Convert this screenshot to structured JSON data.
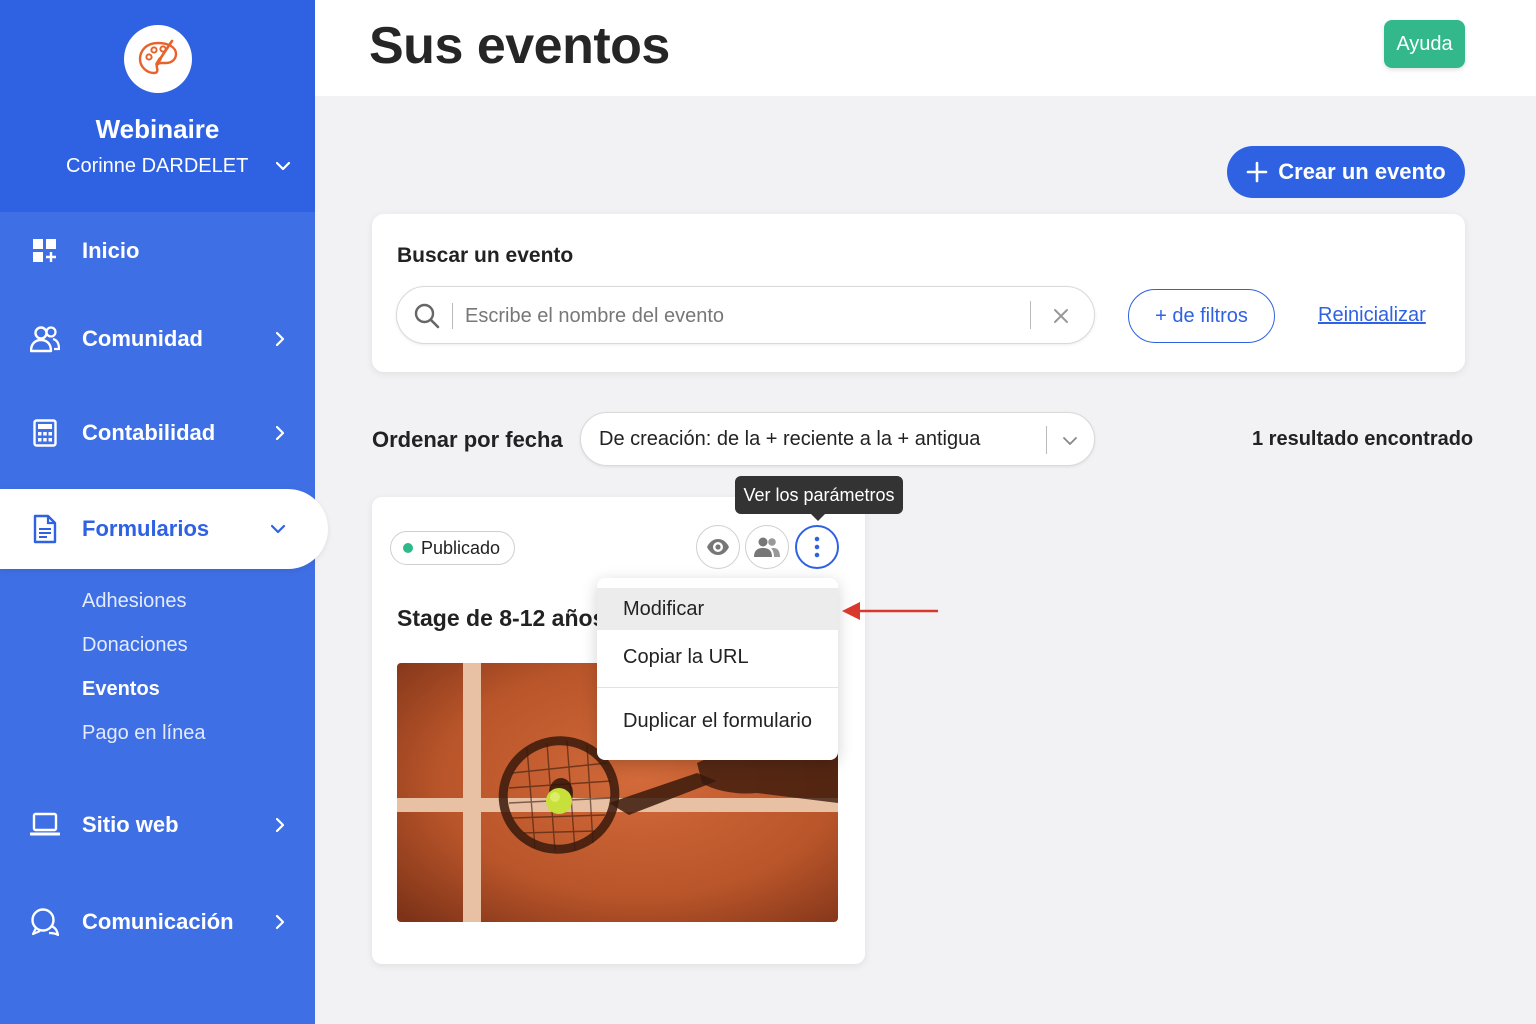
{
  "sidebar": {
    "org_name": "Webinaire",
    "user_name": "Corinne DARDELET",
    "nav": [
      {
        "label": "Inicio",
        "icon": "dashboard-icon"
      },
      {
        "label": "Comunidad",
        "icon": "users-icon"
      },
      {
        "label": "Contabilidad",
        "icon": "calculator-icon"
      },
      {
        "label": "Formularios",
        "icon": "document-icon"
      },
      {
        "label": "Sitio web",
        "icon": "laptop-icon"
      },
      {
        "label": "Comunicación",
        "icon": "chat-icon"
      }
    ],
    "subnav": [
      "Adhesiones",
      "Donaciones",
      "Eventos",
      "Pago en línea"
    ],
    "active_subnav": "Eventos"
  },
  "header": {
    "title": "Sus eventos",
    "help_label": "Ayuda"
  },
  "create_button": "Crear un evento",
  "search": {
    "title": "Buscar un evento",
    "placeholder": "Escribe el nombre del evento",
    "filters_label": "+ de filtros",
    "reset_label": "Reinicializar"
  },
  "sort": {
    "label": "Ordenar por fecha",
    "value": "De creación: de la + reciente a la + antigua",
    "result_count": "1 resultado encontrado"
  },
  "event": {
    "status": "Publicado",
    "title": "Stage de 8-12 años"
  },
  "tooltip": "Ver los parámetros",
  "menu": {
    "items": [
      "Modificar",
      "Copiar la URL",
      "Duplicar el formulario"
    ]
  },
  "colors": {
    "primary": "#2f62e3",
    "sidebar": "#3f6fe4",
    "help": "#33b88c",
    "published": "#2fb889",
    "arrow": "#d9382c"
  }
}
